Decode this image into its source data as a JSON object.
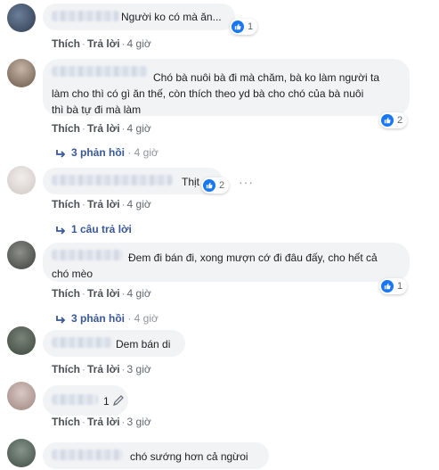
{
  "colors": {
    "link": "#385898",
    "meta": "#606770",
    "bubble": "#f2f3f5",
    "like": "#1877f2"
  },
  "comments": [
    {
      "text": "Người ko có mà ăn...",
      "like_label": "Thích",
      "reply_label": "Trả lời",
      "time": "4 giờ",
      "reactions": "1"
    },
    {
      "text": "Chó bà nuôi bà đi mà chăm, bà ko làm người ta\nlàm cho thì có gì ăn thế, còn thích theo yd bà cho chó của bà nuôi\nthì bà tự đi mà làm",
      "like_label": "Thích",
      "reply_label": "Trả lời",
      "time": "4 giờ",
      "reactions": "2",
      "replies_text": "3 phản hồi",
      "replies_time": "4 giờ"
    },
    {
      "text": "Thịt",
      "like_label": "Thích",
      "reply_label": "Trả lời",
      "time": "4 giờ",
      "reactions": "2",
      "more": "···",
      "replies_text": "1 câu trả lời"
    },
    {
      "text": "Đem đi bán đi, xong mượn cớ đi đâu đấy, cho hết cả\nchó mèo",
      "like_label": "Thích",
      "reply_label": "Trả lời",
      "time": "4 giờ",
      "reactions": "1",
      "replies_text": "3 phản hồi",
      "replies_time": "4 giờ"
    },
    {
      "text": "Dem bán di",
      "like_label": "Thích",
      "reply_label": "Trả lời",
      "time": "3 giờ"
    },
    {
      "text": "1",
      "like_label": "Thích",
      "reply_label": "Trả lời",
      "time": "3 giờ"
    },
    {
      "text": "chó sướng hơn cả ngừoi"
    }
  ]
}
